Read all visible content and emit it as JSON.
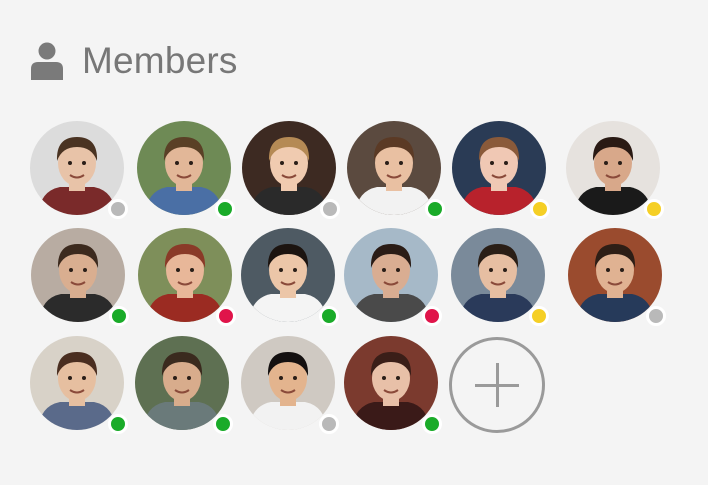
{
  "header": {
    "title": "Members",
    "icon": "user-icon"
  },
  "status_colors": {
    "online": "#1aab29",
    "offline": "#b9b9b9",
    "away": "#f5cf25",
    "busy": "#e0144a"
  },
  "members": [
    {
      "status": "offline",
      "skin": "#e8c3a8",
      "hair": "#4a3322",
      "bg": "#dcdcdc",
      "shirt": "#7a2a2a"
    },
    {
      "status": "online",
      "skin": "#e2b798",
      "hair": "#5a4026",
      "bg": "#6e8a55",
      "shirt": "#4a6fa5"
    },
    {
      "status": "offline",
      "skin": "#f0cbb0",
      "hair": "#b58a55",
      "bg": "#3d2a22",
      "shirt": "#2a2a2a"
    },
    {
      "status": "online",
      "skin": "#e9c0a2",
      "hair": "#5b3a25",
      "bg": "#5b4a3f",
      "shirt": "#f2f2f2"
    },
    {
      "status": "away",
      "skin": "#f0c8b4",
      "hair": "#8a5a3a",
      "bg": "#2a3b55",
      "shirt": "#b8222c"
    },
    {
      "status": "away",
      "skin": "#d8a88a",
      "hair": "#2a1a14",
      "bg": "#e6e2de",
      "shirt": "#1a1a1a"
    },
    {
      "status": "online",
      "skin": "#d9ae90",
      "hair": "#3c2a1e",
      "bg": "#b8aca2",
      "shirt": "#2b2b2b"
    },
    {
      "status": "busy",
      "skin": "#e8b799",
      "hair": "#8a3a28",
      "bg": "#7e8f5a",
      "shirt": "#9b2b22"
    },
    {
      "status": "online",
      "skin": "#ecc6a8",
      "hair": "#1c1410",
      "bg": "#4e5a63",
      "shirt": "#f4f4f4"
    },
    {
      "status": "busy",
      "skin": "#d9ad92",
      "hair": "#2a1c16",
      "bg": "#a6b9c8",
      "shirt": "#4a4a4a"
    },
    {
      "status": "away",
      "skin": "#e6bea2",
      "hair": "#2a1e16",
      "bg": "#7a8a9a",
      "shirt": "#2a3a5a"
    },
    {
      "status": "offline",
      "skin": "#e0b292",
      "hair": "#2e1e16",
      "bg": "#9a4b2e",
      "shirt": "#263a5a"
    },
    {
      "status": "online",
      "skin": "#e6bfa0",
      "hair": "#4a2e20",
      "bg": "#d8d2c8",
      "shirt": "#5a6a8a"
    },
    {
      "status": "online",
      "skin": "#d8ac8c",
      "hair": "#3a2a1e",
      "bg": "#5e7052",
      "shirt": "#6a7a7a"
    },
    {
      "status": "offline",
      "skin": "#e3b48e",
      "hair": "#141010",
      "bg": "#cfc9c2",
      "shirt": "#f2f2f2"
    },
    {
      "status": "online",
      "skin": "#e8c0a8",
      "hair": "#3a1e18",
      "bg": "#7b3a2e",
      "shirt": "#3a1a18"
    }
  ],
  "add_button": {
    "icon": "plus-icon"
  }
}
